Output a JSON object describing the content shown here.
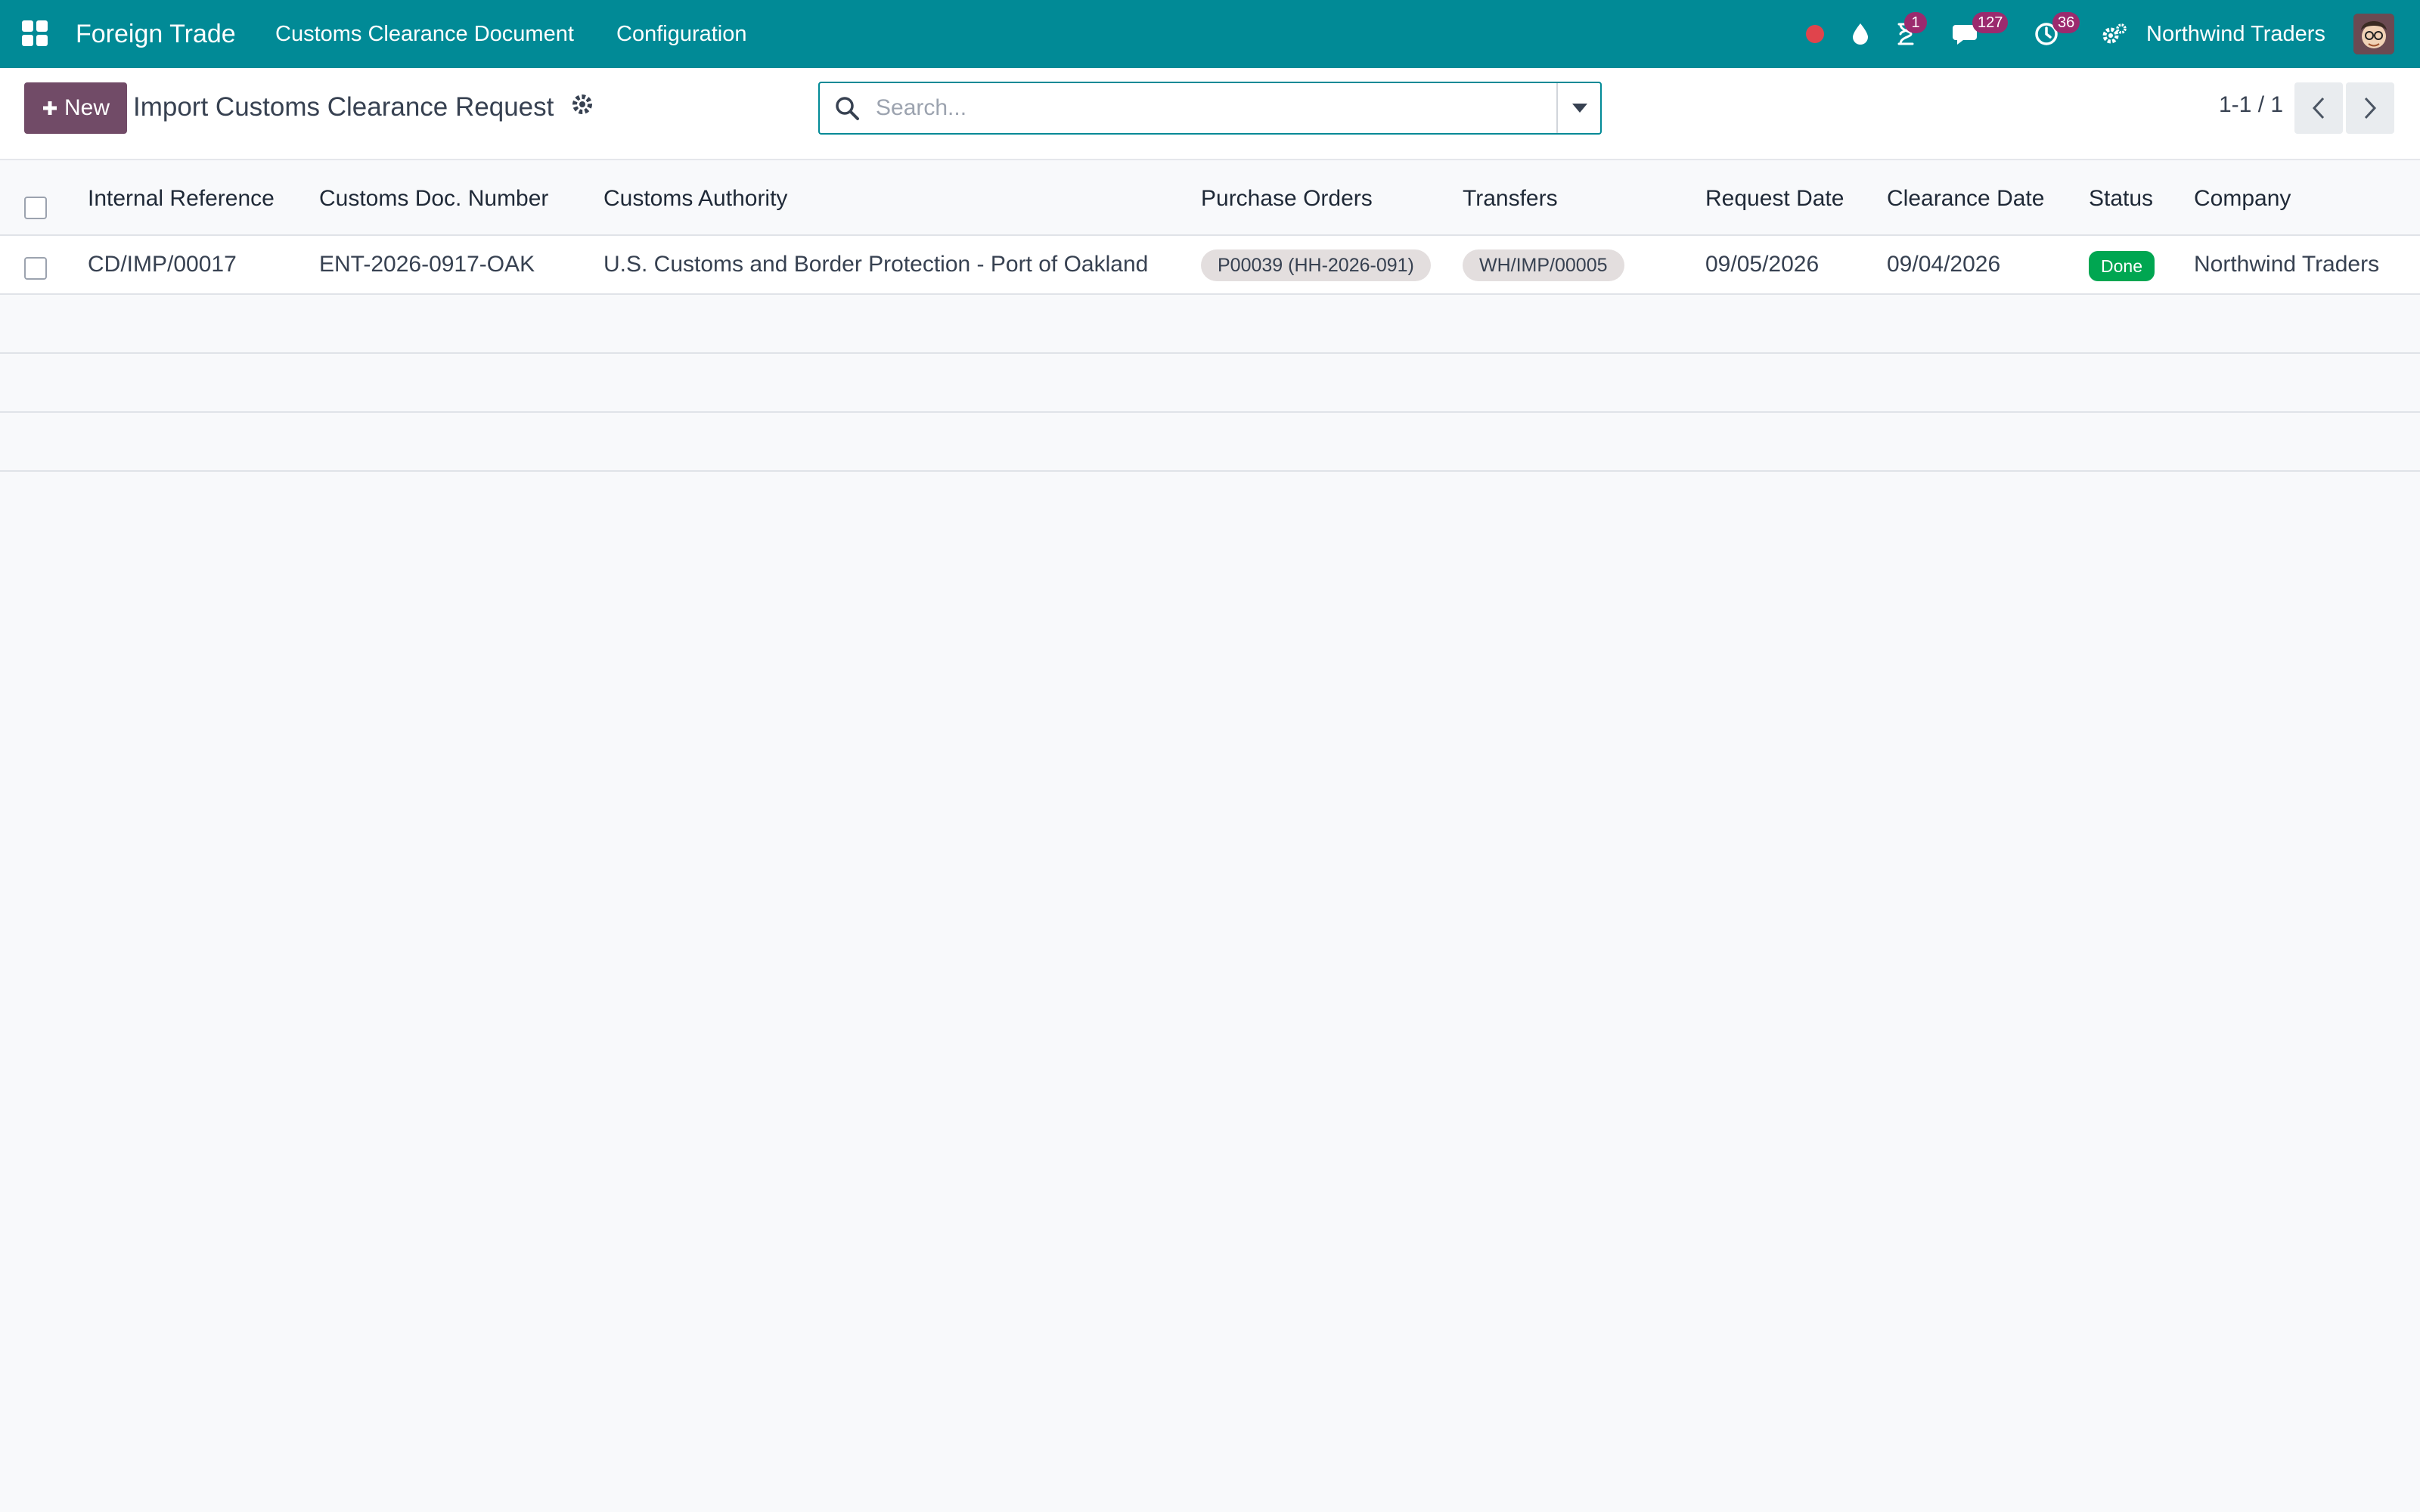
{
  "navbar": {
    "app_name": "Foreign Trade",
    "menu": [
      {
        "label": "Customs Clearance Document"
      },
      {
        "label": "Configuration"
      }
    ],
    "activity_badge": "1",
    "messages_badge": "127",
    "clock_badge": "36",
    "company": "Northwind Traders"
  },
  "control_panel": {
    "new_label": "New",
    "title": "Import Customs Clearance Request",
    "search_placeholder": "Search...",
    "pager": "1-1 / 1"
  },
  "table": {
    "columns": [
      "Internal Reference",
      "Customs Doc. Number",
      "Customs Authority",
      "Purchase Orders",
      "Transfers",
      "Request Date",
      "Clearance Date",
      "Status",
      "Company"
    ],
    "rows": [
      {
        "internal_reference": "CD/IMP/00017",
        "customs_doc_number": "ENT-2026-0917-OAK",
        "customs_authority": "U.S. Customs and Border Protection - Port of Oakland",
        "purchase_orders": "P00039 (HH-2026-091)",
        "transfers": "WH/IMP/00005",
        "request_date": "09/05/2026",
        "clearance_date": "09/04/2026",
        "status": "Done",
        "company": "Northwind Traders"
      }
    ]
  },
  "colors": {
    "navbar": "#018a96",
    "primary_button": "#714b67",
    "status_done": "#00a651",
    "badge": "#9b2a6e",
    "record_dot": "#e0444c"
  },
  "icons": [
    "apps-grid-icon",
    "record-dot-icon",
    "drop-icon",
    "hourglass-icon",
    "chat-icon",
    "clock-icon",
    "settings-icon",
    "gear-icon",
    "search-icon",
    "caret-down-icon",
    "chevron-left-icon",
    "chevron-right-icon",
    "plus-icon"
  ]
}
